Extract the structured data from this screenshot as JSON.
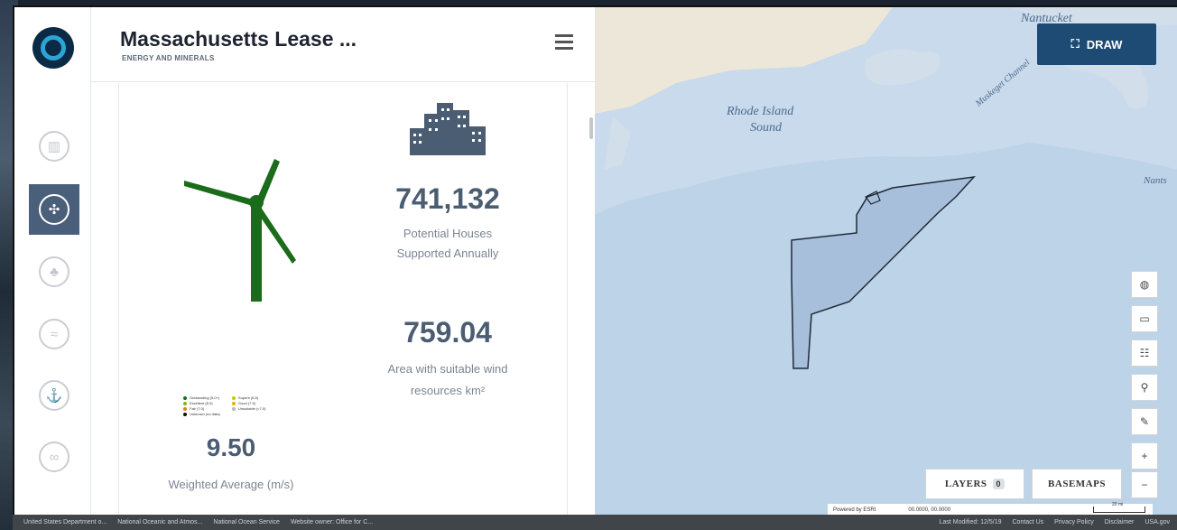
{
  "app": {
    "title": "Massachusetts Lease ...",
    "subtitle": "ENERGY AND MINERALS"
  },
  "sidebar": {
    "items": [
      {
        "icon": "chart-icon",
        "active": false
      },
      {
        "icon": "wind-turbine-icon",
        "active": true
      },
      {
        "icon": "plant-icon",
        "active": false
      },
      {
        "icon": "wave-icon",
        "active": false
      },
      {
        "icon": "ship-icon",
        "active": false
      },
      {
        "icon": "fish-icon",
        "active": false
      }
    ]
  },
  "stats": {
    "houses_value": "741,132",
    "houses_label_1": "Potential Houses",
    "houses_label_2": "Supported Annually",
    "area_value": "759.04",
    "area_label_1": "Area with suitable wind",
    "area_label_2": "resources km²",
    "speed_value": "9.50",
    "speed_label": "Weighted Average (m/s)"
  },
  "legend": {
    "col1": [
      {
        "label": "Outstanding (9.0+)",
        "color": "#1a6b1a"
      },
      {
        "label": "Excellent (8.0)",
        "color": "#7fb800"
      },
      {
        "label": "Fair (7.0)",
        "color": "#d98a00"
      },
      {
        "label": "Unknown (no data)",
        "color": "#111111"
      }
    ],
    "col2": [
      {
        "label": "Superb (8.5)",
        "color": "#c8c800"
      },
      {
        "label": "Good (7.5)",
        "color": "#e8b100"
      },
      {
        "label": "Unsuitable (<7.0)",
        "color": "#bbbbbb"
      }
    ]
  },
  "map": {
    "draw_label": "DRAW",
    "layers_label": "LAYERS",
    "layers_count": "0",
    "basemaps_label": "BASEMAPS",
    "place_labels": {
      "nantucket": "Nantucket",
      "rhode_island_1": "Rhode Island",
      "rhode_island_2": "Sound",
      "muskeget": "Muskeget Channel",
      "nants": "Nants"
    },
    "tools": [
      "globe-icon",
      "keyboard-icon",
      "people-icon",
      "search-icon",
      "measure-icon",
      "zoom-in-icon",
      "zoom-out-icon"
    ],
    "zoom_in": "+",
    "zoom_out": "−",
    "attribution": "Powered by ESRI",
    "coordinates": "00.0000, 00.0000",
    "scale": "20 mi"
  },
  "footer": {
    "links_left": [
      "United States Department o...",
      "National Oceanic and Atmos...",
      "National Ocean Service",
      "Website owner: Office for C..."
    ],
    "links_right": [
      "Last Modified: 12/5/19",
      "Contact Us",
      "Privacy Policy",
      "Disclaimer",
      "USA.gov"
    ]
  },
  "colors": {
    "accent": "#1e4b73",
    "rail_active": "#4a5f7a",
    "turbine": "#1a6b1a",
    "stat_text": "#4b5d72"
  }
}
